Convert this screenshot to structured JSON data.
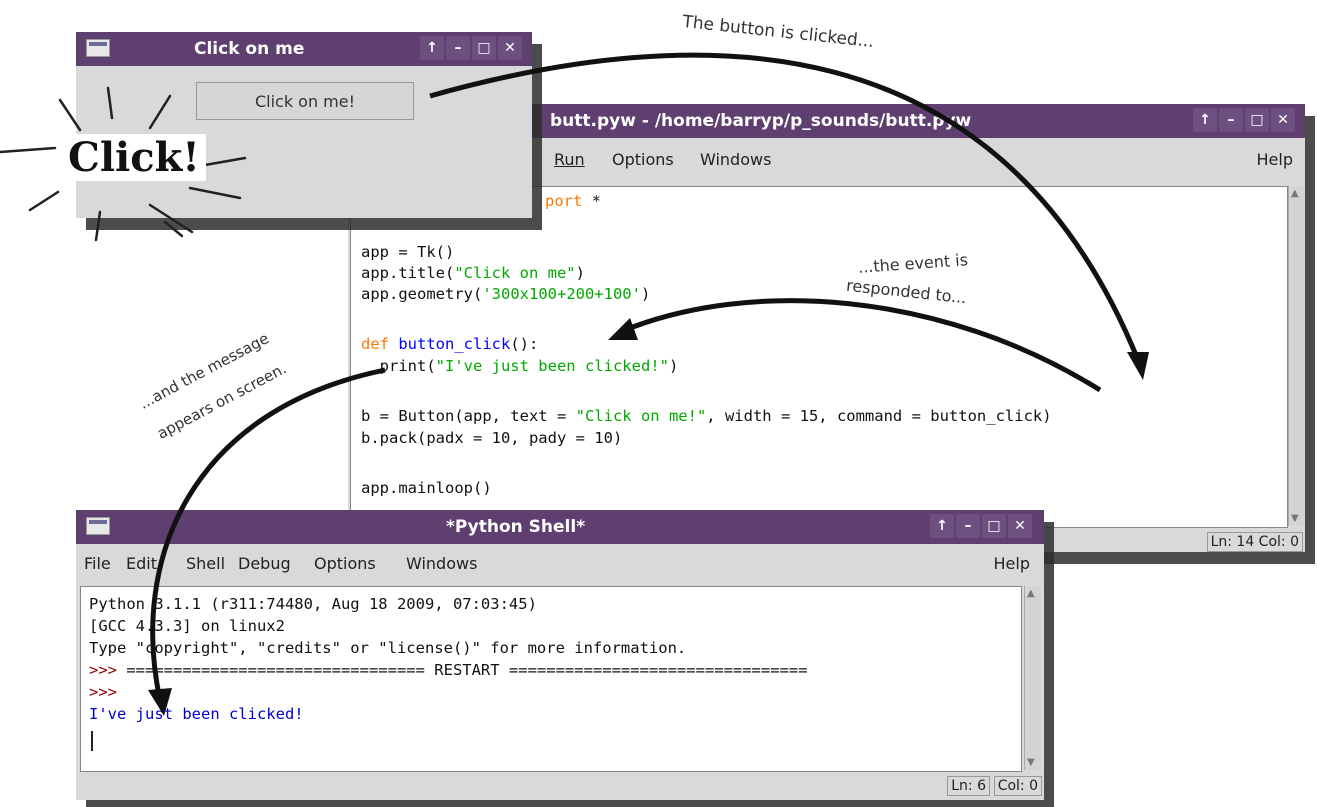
{
  "click_window": {
    "title": "Click on me",
    "button_label": "Click on me!"
  },
  "editor_window": {
    "title": "butt.pyw - /home/barryp/p_sounds/butt.pyw",
    "menu": [
      "Run",
      "Options",
      "Windows"
    ],
    "menu_help": "Help",
    "code": {
      "l1_kw": "port",
      "l1_rest": " *",
      "l2": "app = Tk()",
      "l3_a": "app.title(",
      "l3_s": "\"Click on me\"",
      "l3_b": ")",
      "l4_a": "app.geometry(",
      "l4_s": "'300x100+200+100'",
      "l4_b": ")",
      "l5_kw": "def",
      "l5_name": " button_click",
      "l5_rest": "():",
      "l6_a": "  print(",
      "l6_s": "\"I've just been clicked!\"",
      "l6_b": ")",
      "l7_a": "b = Button(app, text = ",
      "l7_s": "\"Click on me!\"",
      "l7_b": ", width = 15, command = button_click)",
      "l8": "b.pack(padx = 10, pady = 10)",
      "l9": "app.mainloop()"
    },
    "status": "Ln: 14 Col: 0"
  },
  "shell_window": {
    "title": "*Python Shell*",
    "menu": [
      "File",
      "Edit",
      "Shell",
      "Debug",
      "Options",
      "Windows"
    ],
    "menu_help": "Help",
    "lines": {
      "l1": "Python 3.1.1 (r311:74480, Aug 18 2009, 07:03:45)",
      "l2": "[GCC 4.3.3] on linux2",
      "l3": "Type \"copyright\", \"credits\" or \"license()\" for more information.",
      "l4_prompt": ">>> ",
      "l4_rest": "================================ RESTART ================================",
      "l5_prompt": ">>>",
      "l6": "I've just been clicked!"
    },
    "status_ln": "Ln: 6",
    "status_col": "Col: 0"
  },
  "annotations": {
    "click": "Click!",
    "clicked": "The button is clicked...",
    "event_1": "...the event is",
    "event_2": "responded to...",
    "message_1": "...and the message",
    "message_2": "appears on screen."
  },
  "colors": {
    "titlebar": "#5e3f6f",
    "keyword": "#ff7700",
    "string": "#00aa00",
    "definition": "#0000ff",
    "output": "#0000cc"
  }
}
